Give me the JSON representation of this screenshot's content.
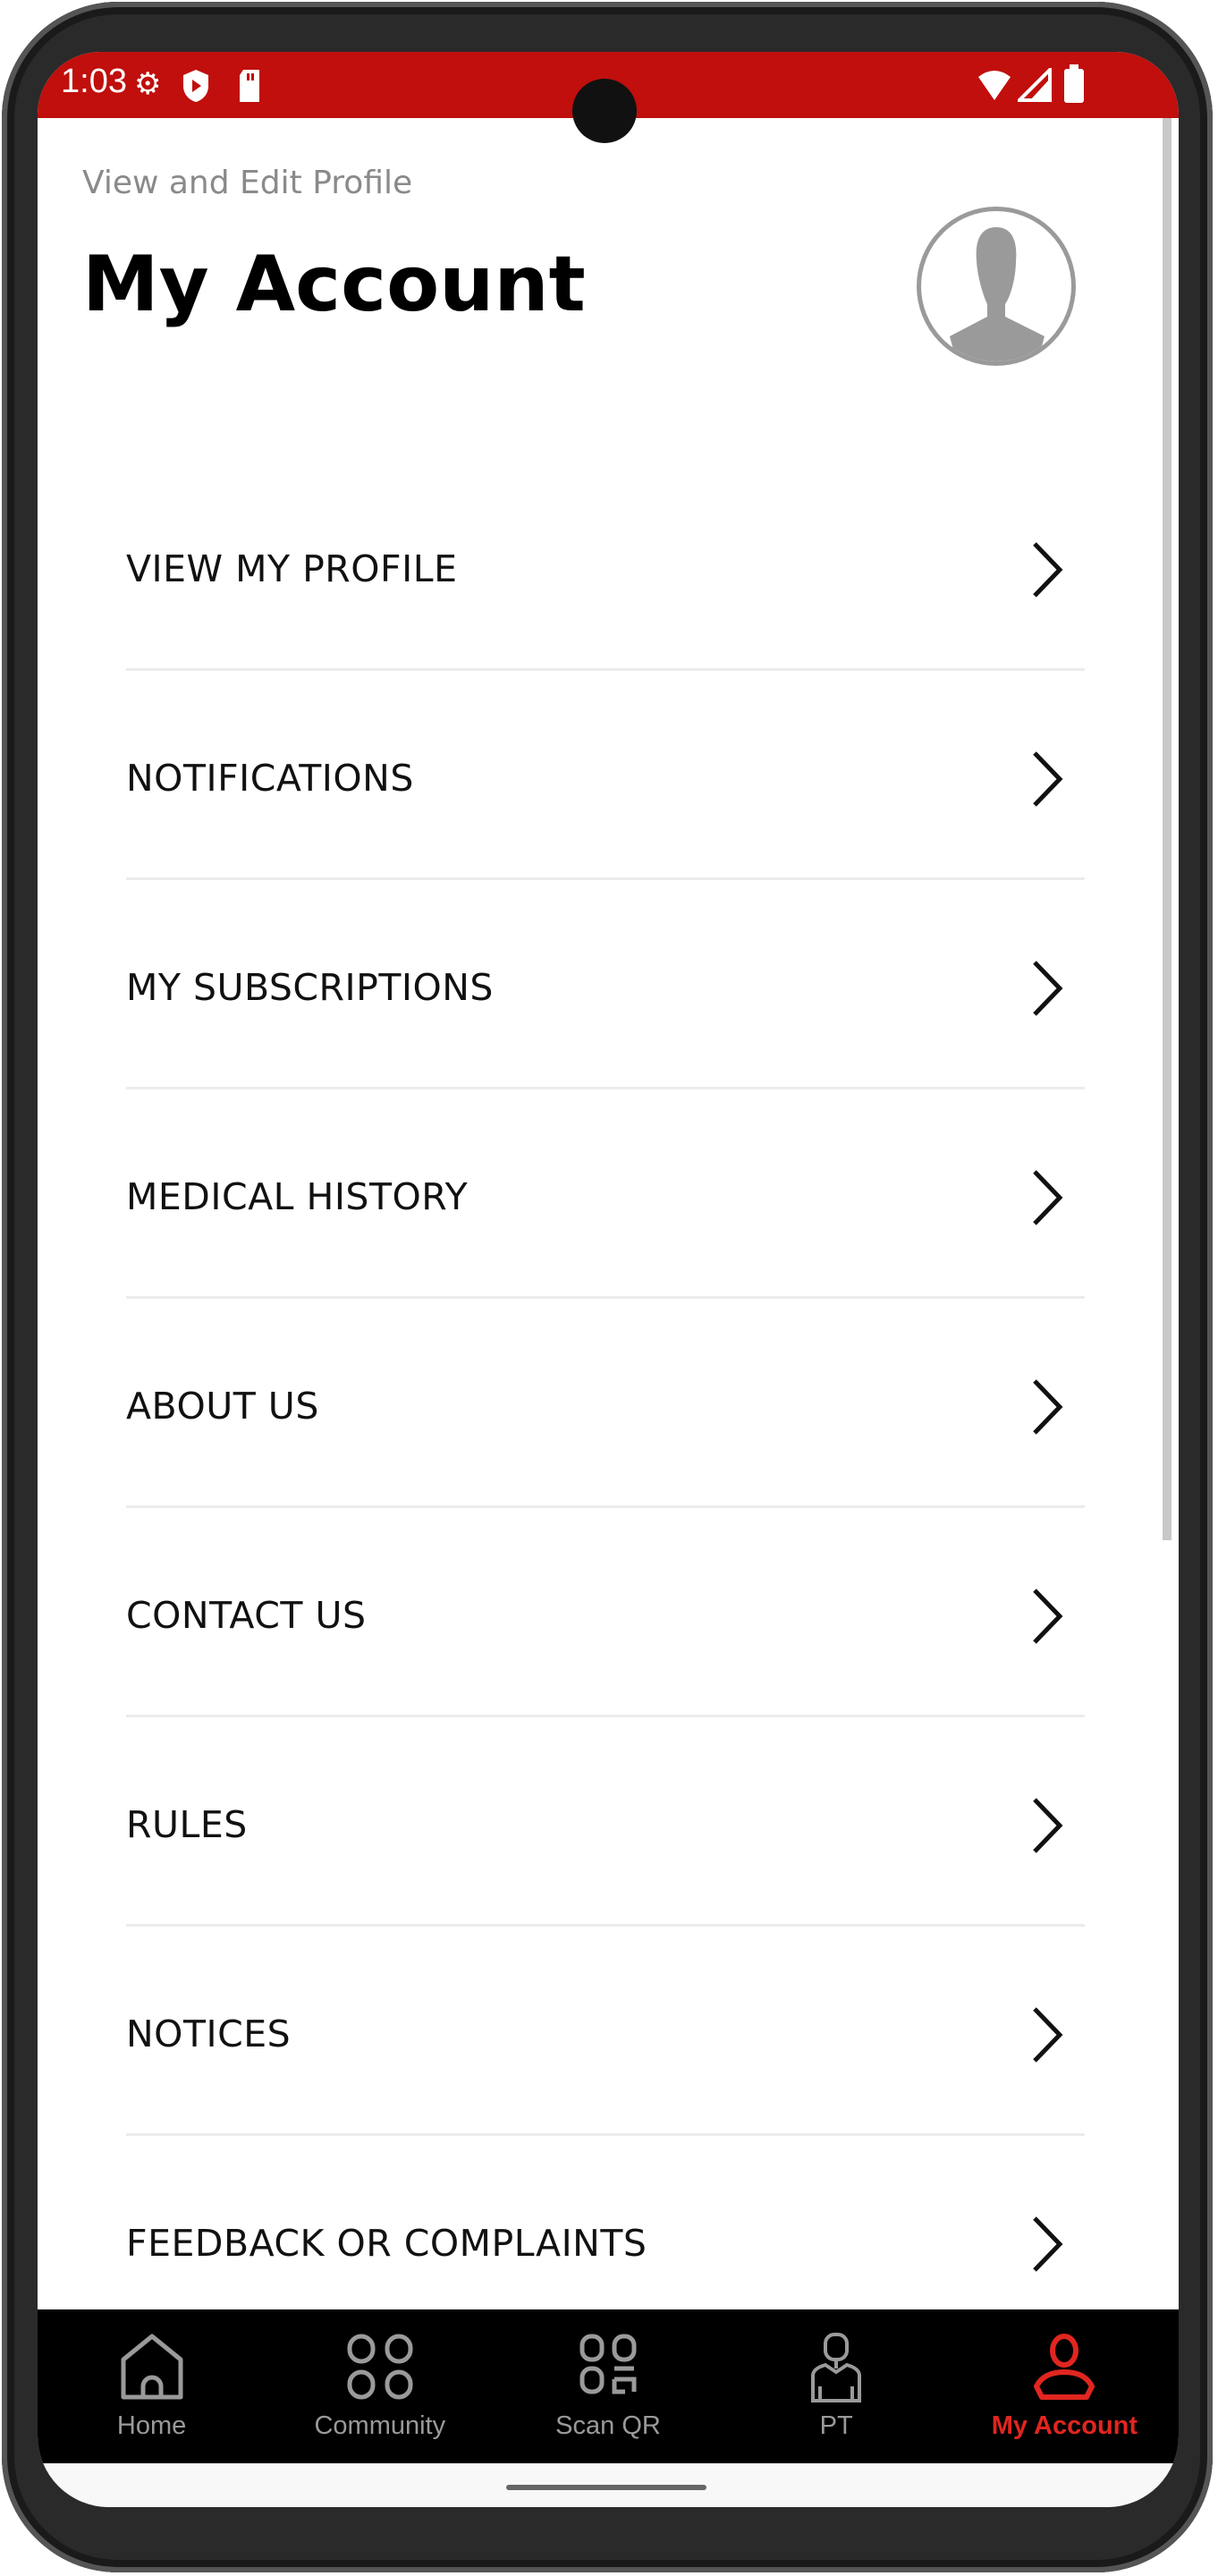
{
  "status_bar": {
    "time": "1:03",
    "icons": [
      "gear-icon",
      "play-shield-icon",
      "sd-card-icon",
      "wifi-icon",
      "signal-icon",
      "battery-icon"
    ],
    "color": "#c00f0c"
  },
  "header": {
    "subtitle": "View and Edit Profile",
    "title": "My Account"
  },
  "menu": {
    "items": [
      {
        "label": "VIEW MY PROFILE"
      },
      {
        "label": "NOTIFICATIONS"
      },
      {
        "label": "MY SUBSCRIPTIONS"
      },
      {
        "label": "MEDICAL HISTORY"
      },
      {
        "label": "ABOUT US"
      },
      {
        "label": "CONTACT US"
      },
      {
        "label": "RULES"
      },
      {
        "label": "NOTICES"
      },
      {
        "label": "FEEDBACK OR COMPLAINTS"
      }
    ]
  },
  "bottom_nav": {
    "items": [
      {
        "label": "Home",
        "icon": "home-icon"
      },
      {
        "label": "Community",
        "icon": "community-icon"
      },
      {
        "label": "Scan QR",
        "icon": "qr-icon"
      },
      {
        "label": "PT",
        "icon": "trainer-icon"
      },
      {
        "label": "My Account",
        "icon": "user-icon",
        "active": true
      }
    ],
    "active_color": "#e0261f",
    "inactive_color": "#9a9a9a"
  }
}
